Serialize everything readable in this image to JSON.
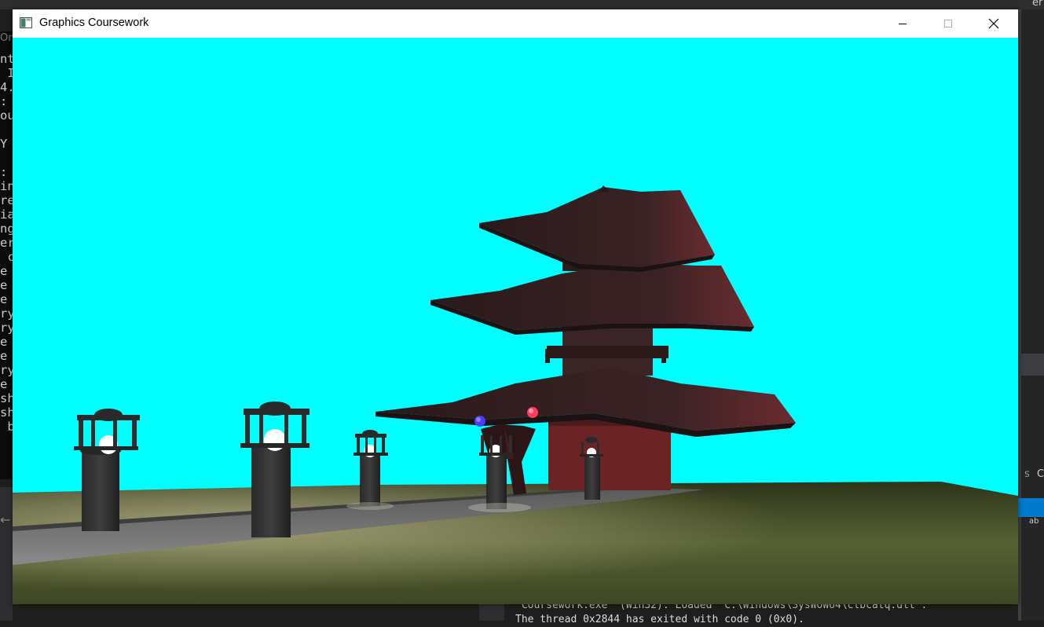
{
  "window": {
    "title": "Graphics Coursework",
    "icon": "app-window-icon",
    "controls": {
      "minimize": "minimize-icon",
      "maximize": "maximize-icon",
      "close": "close-icon"
    }
  },
  "scene": {
    "sky_color": "#00ffff",
    "ground_color": "#4f5a2e",
    "path_color": "#6e6e6e",
    "pagoda_color": "#3a2022",
    "light_orb_colors": [
      "#4a3cff",
      "#ff3a5a"
    ],
    "lamp_count": 5
  },
  "background": {
    "console_lines": [
      "nt",
      " I",
      "4.",
      ":",
      "ou",
      "",
      "Y",
      "",
      ":",
      "in",
      "re",
      "ia",
      "ng",
      "er",
      " c",
      "e",
      "e",
      "e",
      "ry",
      "ry",
      "e",
      "e",
      "ry",
      "e",
      "sh",
      "sh",
      " b"
    ],
    "console_top_text": "On",
    "top_right_text": "er",
    "right_panel_texts": [
      "s",
      "C",
      "ab"
    ],
    "output_lines": [
      "'Coursework.exe' (Win32): Loaded 'C:\\Windows\\SysWOW64\\clbcatq.dll'.",
      "The thread 0x2844 has exited with code 0 (0x0)."
    ]
  }
}
